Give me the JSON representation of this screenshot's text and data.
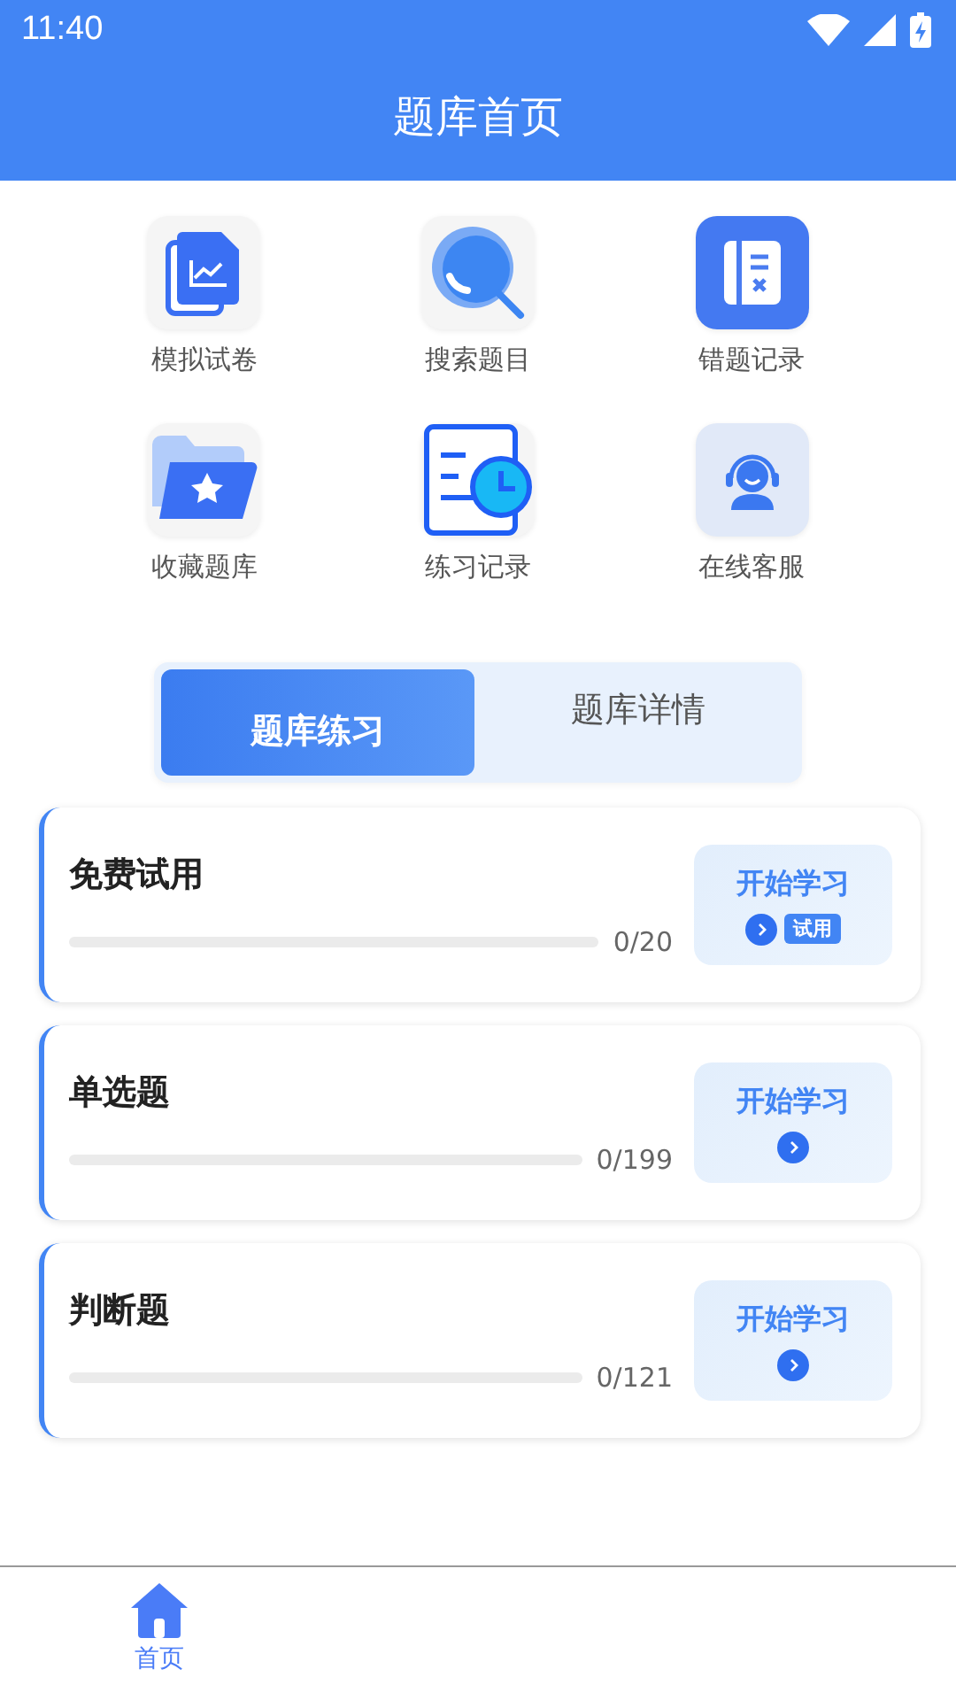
{
  "status_bar": {
    "time": "11:40"
  },
  "header": {
    "title": "题库首页"
  },
  "shortcuts": [
    {
      "label": "模拟试卷",
      "kind": "papers"
    },
    {
      "label": "搜索题目",
      "kind": "search"
    },
    {
      "label": "错题记录",
      "kind": "wrong"
    },
    {
      "label": "收藏题库",
      "kind": "folder"
    },
    {
      "label": "练习记录",
      "kind": "history"
    },
    {
      "label": "在线客服",
      "kind": "service"
    }
  ],
  "segments": [
    {
      "label": "题库练习",
      "selected": true
    },
    {
      "label": "题库详情",
      "selected": false
    }
  ],
  "practice_sets": [
    {
      "title": "免费试用",
      "level": 0,
      "progress": "0/20",
      "button": "开始学习",
      "badge": "试用"
    },
    {
      "title": "单选题",
      "level": 0,
      "progress": "0/199",
      "button": "开始学习"
    },
    {
      "title": "判断题",
      "level": 0,
      "progress": "0/121",
      "button": "开始学习"
    }
  ],
  "bottom_nav": [
    {
      "label": "首页",
      "selected": true
    }
  ]
}
